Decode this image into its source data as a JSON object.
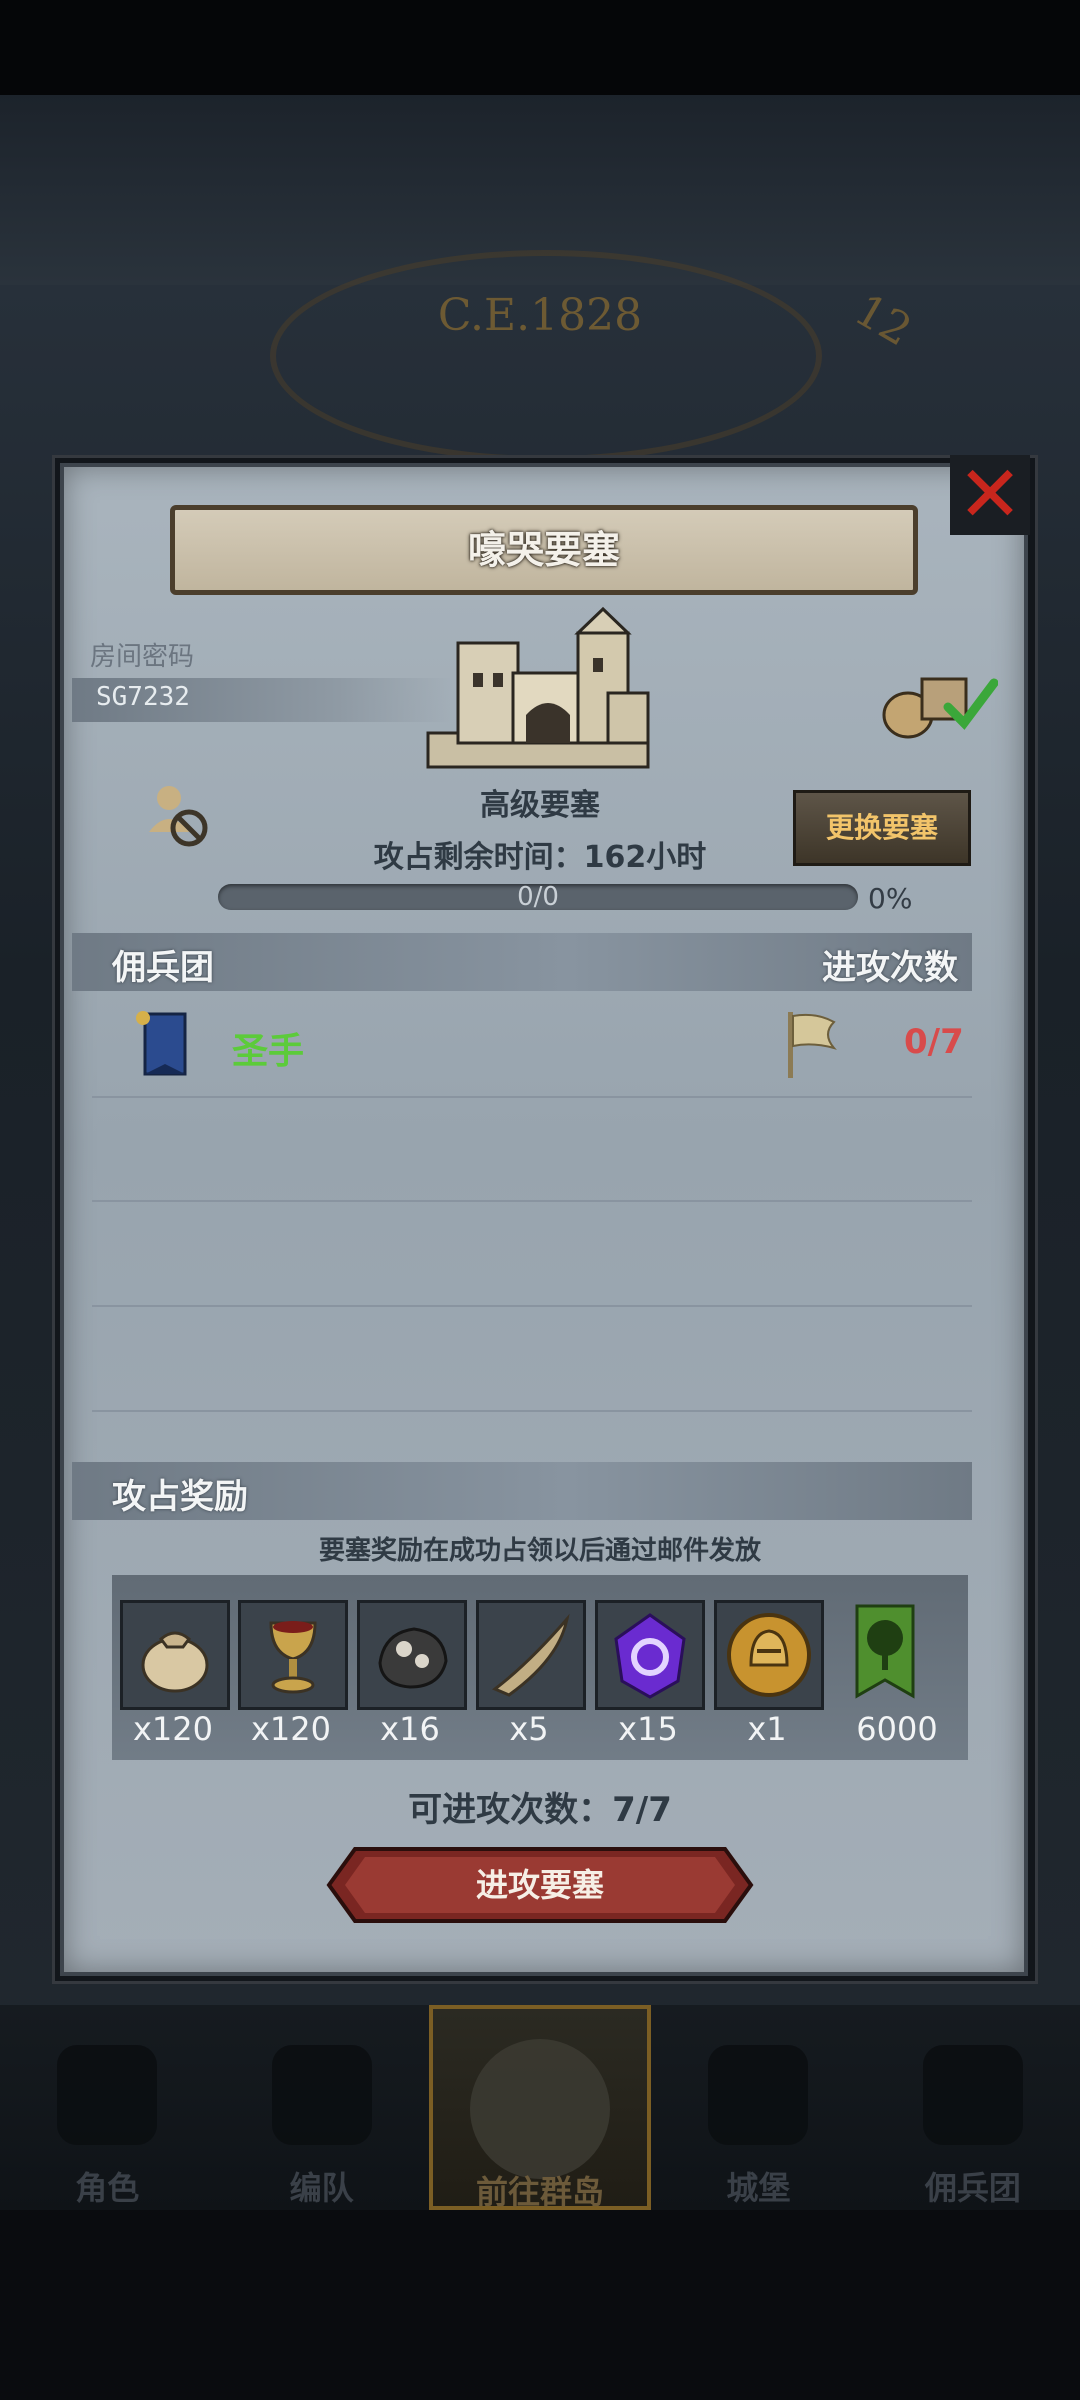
{
  "background": {
    "era": "C.E.1828",
    "clock_number": "12"
  },
  "modal": {
    "title": "嚎哭要塞",
    "close_icon": "close-icon",
    "room": {
      "label": "房间密码",
      "code": "SG7232"
    },
    "fortress": {
      "type": "高级要塞",
      "icon": "castle-icon"
    },
    "change_button": "更换要塞",
    "time_remaining": "攻占剩余时间：162小时",
    "progress": {
      "text": "0/0",
      "percent": "0%",
      "fraction": 0
    },
    "mercenary_section": {
      "title": "佣兵团",
      "attack_title": "进攻次数"
    },
    "mercenaries": [
      {
        "name": "圣手",
        "attacks": "0/7",
        "name_color": "#5ccb3a",
        "attacks_color": "#d84b4b"
      }
    ],
    "rewards_section": {
      "title": "攻占奖励",
      "note": "要塞奖励在成功占领以后通过邮件发放",
      "items": [
        {
          "icon": "sack-icon",
          "qty": "x120"
        },
        {
          "icon": "goblet-icon",
          "qty": "x120"
        },
        {
          "icon": "ore-icon",
          "qty": "x16"
        },
        {
          "icon": "horn-icon",
          "qty": "x5"
        },
        {
          "icon": "purple-crystal-icon",
          "qty": "x15"
        },
        {
          "icon": "gold-helmet-coin-icon",
          "qty": "x1"
        },
        {
          "icon": "tree-banner-icon",
          "qty": "6000"
        }
      ]
    },
    "attacks_left": "可进攻次数：7/7",
    "attack_button": "进攻要塞"
  },
  "bottom_nav": [
    {
      "label": "角色",
      "icon": "character-icon",
      "active": false
    },
    {
      "label": "编队",
      "icon": "formation-icon",
      "active": false
    },
    {
      "label": "前往群岛",
      "icon": "map-icon",
      "active": true
    },
    {
      "label": "城堡",
      "icon": "castle-nav-icon",
      "active": false
    },
    {
      "label": "佣兵团",
      "icon": "mercenary-icon",
      "active": false
    }
  ]
}
